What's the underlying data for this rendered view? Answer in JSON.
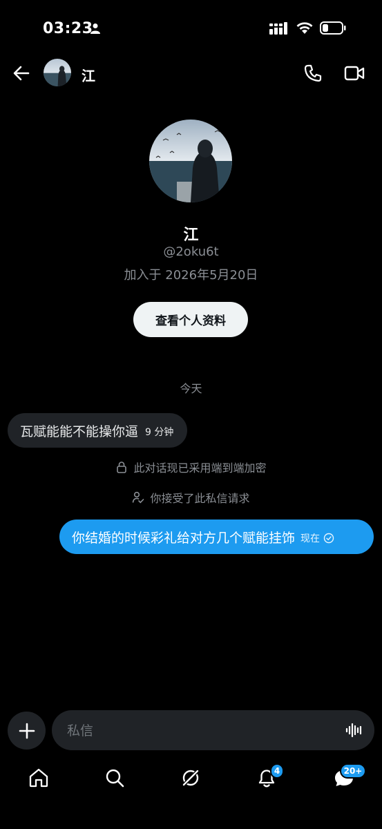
{
  "status_bar": {
    "time": "03:23"
  },
  "header": {
    "contact_name": "江"
  },
  "profile": {
    "name": "江",
    "handle": "@2oku6t",
    "joined": "加入于 2026年5月20日",
    "view_profile_label": "查看个人资料"
  },
  "conversation": {
    "date_separator": "今天",
    "messages": [
      {
        "direction": "incoming",
        "text": "瓦赋能能不能操你逼",
        "time": "9 分钟"
      },
      {
        "direction": "outgoing",
        "text": "你结婚的时候彩礼给对方几个赋能挂饰",
        "time": "现在"
      }
    ],
    "system_messages": [
      {
        "icon": "lock-icon",
        "text": "此对话现已采用端到端加密"
      },
      {
        "icon": "user-check-icon",
        "text": "你接受了此私信请求"
      }
    ]
  },
  "composer": {
    "placeholder": "私信"
  },
  "nav": {
    "items": [
      "home",
      "search",
      "grok",
      "notifications",
      "messages"
    ],
    "notifications_badge": "4",
    "messages_badge": "20+"
  },
  "colors": {
    "accent": "#1d9bf0",
    "bubble_incoming": "#202327",
    "background": "#000000"
  }
}
